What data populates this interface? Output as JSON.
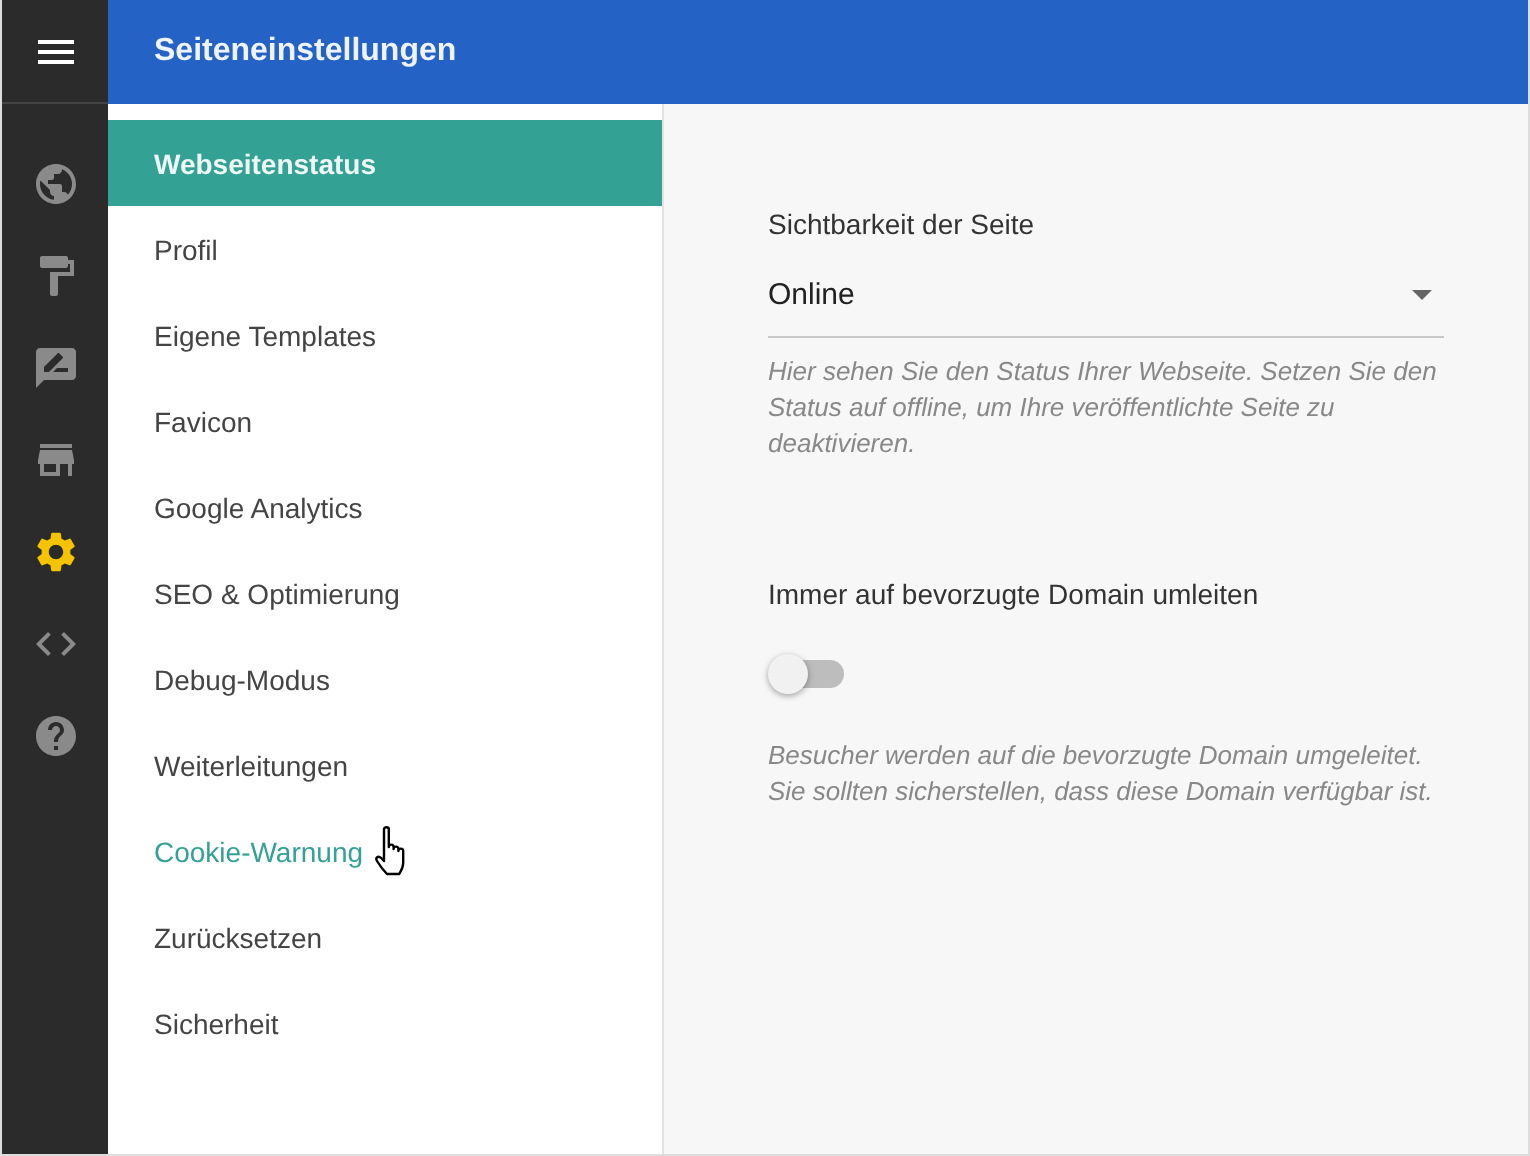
{
  "rail": {
    "items": [
      {
        "kind": "globe",
        "selected": false
      },
      {
        "kind": "roller",
        "selected": false
      },
      {
        "kind": "feedback",
        "selected": false
      },
      {
        "kind": "store",
        "selected": false
      },
      {
        "kind": "gear",
        "selected": true
      },
      {
        "kind": "code",
        "selected": false
      },
      {
        "kind": "help",
        "selected": false
      }
    ]
  },
  "header": {
    "title": "Seiteneinstellungen"
  },
  "menu": {
    "items": [
      {
        "label": "Webseitenstatus",
        "selected": true,
        "hovered": false
      },
      {
        "label": "Profil",
        "selected": false,
        "hovered": false
      },
      {
        "label": "Eigene Templates",
        "selected": false,
        "hovered": false
      },
      {
        "label": "Favicon",
        "selected": false,
        "hovered": false
      },
      {
        "label": "Google Analytics",
        "selected": false,
        "hovered": false
      },
      {
        "label": "SEO & Optimierung",
        "selected": false,
        "hovered": false
      },
      {
        "label": "Debug-Modus",
        "selected": false,
        "hovered": false
      },
      {
        "label": "Weiterleitungen",
        "selected": false,
        "hovered": false
      },
      {
        "label": "Cookie-Warnung",
        "selected": false,
        "hovered": true
      },
      {
        "label": "Zurücksetzen",
        "selected": false,
        "hovered": false
      },
      {
        "label": "Sicherheit",
        "selected": false,
        "hovered": false
      }
    ]
  },
  "settings": [
    {
      "kind": "select",
      "label": "Sichtbarkeit der Seite",
      "value": "Online",
      "help": "Hier sehen Sie den Status Ihrer Webseite. Setzen Sie den Status auf offline, um Ihre veröffentlichte Seite zu deaktivieren."
    },
    {
      "kind": "toggle",
      "label": "Immer auf bevorzugte Domain umleiten",
      "on": false,
      "help": "Besucher werden auf die bevorzugte Domain umgeleitet. Sie sollten sicherstellen, dass diese Domain verfügbar ist."
    }
  ]
}
